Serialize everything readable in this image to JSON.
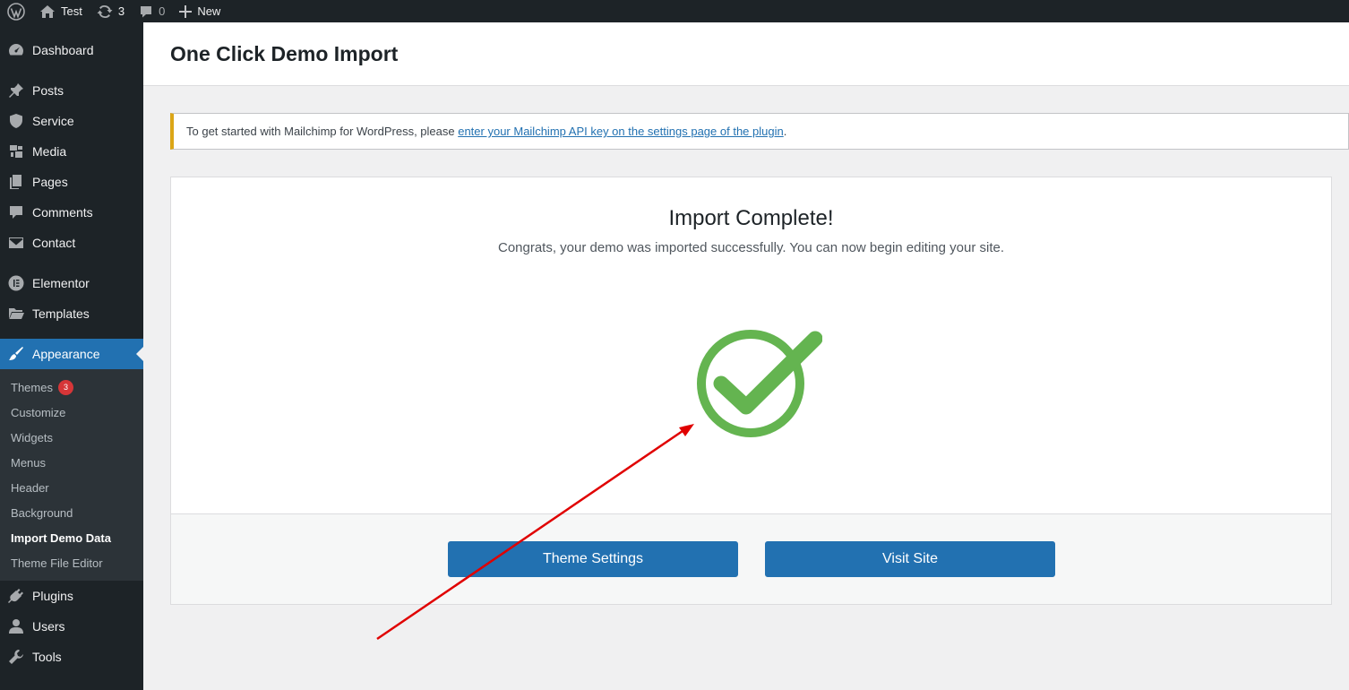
{
  "adminbar": {
    "site_name": "Test",
    "updates_count": "3",
    "comments_count": "0",
    "new_label": "New"
  },
  "sidebar": {
    "items": [
      {
        "label": "Dashboard",
        "icon": "dashboard-icon"
      },
      {
        "label": "Posts",
        "icon": "pin-icon"
      },
      {
        "label": "Service",
        "icon": "shield-icon"
      },
      {
        "label": "Media",
        "icon": "media-icon"
      },
      {
        "label": "Pages",
        "icon": "pages-icon"
      },
      {
        "label": "Comments",
        "icon": "comment-icon"
      },
      {
        "label": "Contact",
        "icon": "envelope-icon"
      },
      {
        "label": "Elementor",
        "icon": "elementor-icon"
      },
      {
        "label": "Templates",
        "icon": "folder-icon"
      },
      {
        "label": "Appearance",
        "icon": "brush-icon"
      },
      {
        "label": "Plugins",
        "icon": "plug-icon"
      },
      {
        "label": "Users",
        "icon": "user-icon"
      },
      {
        "label": "Tools",
        "icon": "wrench-icon"
      }
    ],
    "submenu": [
      {
        "label": "Themes",
        "badge": "3"
      },
      {
        "label": "Customize"
      },
      {
        "label": "Widgets"
      },
      {
        "label": "Menus"
      },
      {
        "label": "Header"
      },
      {
        "label": "Background"
      },
      {
        "label": "Import Demo Data"
      },
      {
        "label": "Theme File Editor"
      }
    ]
  },
  "header": {
    "title": "One Click Demo Import"
  },
  "notice": {
    "text_before": "To get started with Mailchimp for WordPress, please ",
    "link_text": "enter your Mailchimp API key on the settings page of the plugin",
    "text_after": "."
  },
  "card": {
    "title": "Import Complete!",
    "subtitle": "Congrats, your demo was imported successfully. You can now begin editing your site.",
    "check_color": "#64b450",
    "buttons": {
      "theme_settings": "Theme Settings",
      "visit_site": "Visit Site"
    }
  },
  "colors": {
    "accent": "#2271b1",
    "adminbar": "#1d2327",
    "notice_border": "#dba617",
    "annotation_arrow": "#e00000"
  }
}
